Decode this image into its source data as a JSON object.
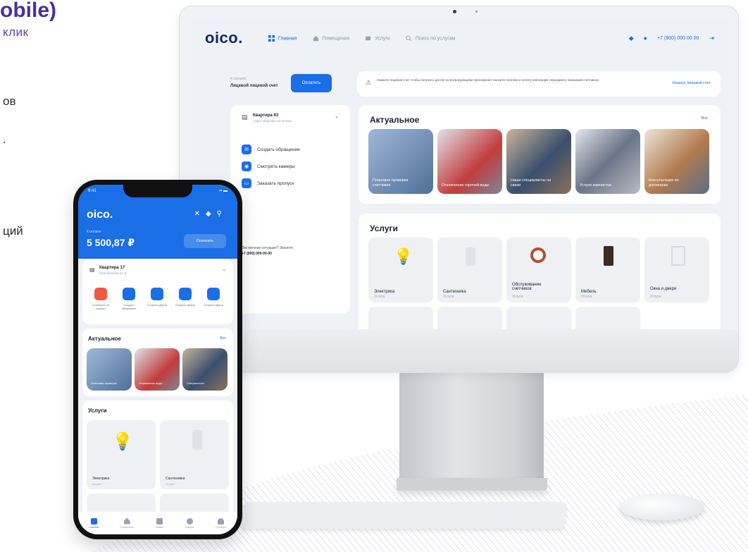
{
  "promo": {
    "title": "obile)",
    "subtitle": "клик",
    "lines": [
      "ов",
      ".",
      "ций"
    ]
  },
  "colors": {
    "brand_blue": "#1a6ee6",
    "promo_purple": "#4a2f9c",
    "logo_navy": "#0f2a6b"
  },
  "desktop": {
    "logo": "oico.",
    "nav": [
      {
        "label": "Главная",
        "icon": "grid-icon",
        "active": true
      },
      {
        "label": "Помещения",
        "icon": "home-icon",
        "active": false
      },
      {
        "label": "Услуги",
        "icon": "services-icon",
        "active": false
      },
      {
        "label": "Поиск по услугам",
        "icon": "search-icon",
        "active": false
      }
    ],
    "phone_number": "+7 (900) 000 00 00",
    "balance_label": "К оплате",
    "balance_caption": "Лицевой лицевой счет",
    "pay_button": "Оплатить",
    "alert_text": "Укажите лицевой счет, чтобы получить доступ ко всем функциям приложения: вносите платежи и оплату квитанций, передавать показания счетчиков.",
    "alert_link": "Указать лицевой счет",
    "apartment": {
      "name": "Квартира 63",
      "address": "Адрес квартиры не указан"
    },
    "side_actions": [
      "Создать обращение",
      "Смотреть камеры",
      "Заказать пропуск"
    ],
    "contact_text": "Экстренная ситуация? Звоните",
    "contact_phone": "+7 (000) 000-00-00",
    "actual_title": "Актуальное",
    "see_all": "Все",
    "actual_items": [
      "Плановая проверка счетчиков",
      "Отключение горячей воды",
      "Наши специалисты на связи",
      "Услуги химчистки",
      "Консультация по договорам"
    ],
    "services_title": "Услуги",
    "services": [
      {
        "name": "Электрика",
        "sub": "Услуги"
      },
      {
        "name": "Сантехника",
        "sub": "Услуги"
      },
      {
        "name": "Обслуживание счетчиков",
        "sub": "Услуги"
      },
      {
        "name": "Мебель",
        "sub": "Услуги"
      },
      {
        "name": "Окна и двери",
        "sub": "Услуги"
      }
    ]
  },
  "mobile": {
    "time": "9:41",
    "logo": "oico.",
    "balance_label": "К оплате",
    "balance": "5 500,87 ₽",
    "pay_button": "Оплатить",
    "apartment": {
      "name": "Квартира 17",
      "address": "Пресненская ул. 6"
    },
    "quick_actions": [
      {
        "label": "Сообщить об аварии",
        "color": "#ef5a3c"
      },
      {
        "label": "Создать обращение",
        "color": "#1a6ee6"
      },
      {
        "label": "Открыть двери",
        "color": "#1a6ee6"
      },
      {
        "label": "Открыть двери",
        "color": "#1a6ee6"
      },
      {
        "label": "Открыть двери",
        "color": "#1a6ee6"
      }
    ],
    "actual_title": "Актуальное",
    "see_all": "Все",
    "actual_items": [
      "Плановая проверка",
      "Отключение воды",
      "Специалисты"
    ],
    "services_title": "Услуги",
    "services": [
      {
        "name": "Электрика",
        "sub": "Услуги"
      },
      {
        "name": "Сантехника",
        "sub": "Услуги"
      }
    ],
    "tabs": [
      "Главная",
      "Помещения",
      "Заявки",
      "Камеры",
      "Профиль"
    ]
  }
}
